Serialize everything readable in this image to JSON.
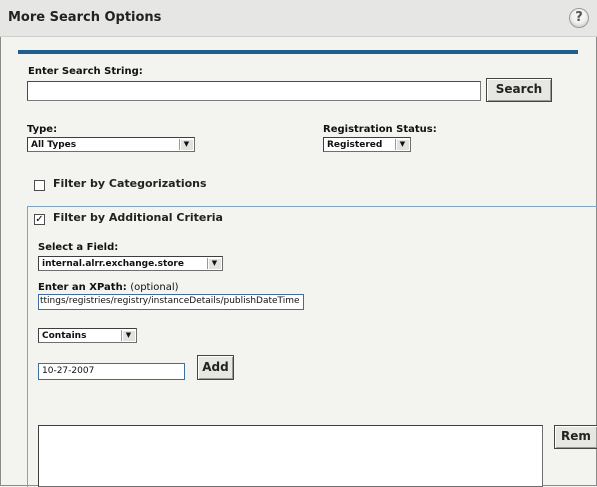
{
  "header": {
    "title": "More Search Options",
    "help_glyph": "?"
  },
  "search": {
    "label": "Enter Search String:",
    "value": "",
    "button_label": "Search"
  },
  "type_filter": {
    "label": "Type:",
    "selected": "All Types"
  },
  "registration_status": {
    "label": "Registration Status:",
    "selected": "Registered"
  },
  "categorizations": {
    "label": "Filter by Categorizations",
    "checked": false
  },
  "additional_criteria": {
    "label": "Filter by Additional Criteria",
    "checked": true,
    "check_glyph": "✓",
    "field_label": "Select a Field:",
    "field_selected": "internal.alrr.exchange.store",
    "xpath_label": "Enter an XPath:",
    "xpath_optional": "(optional)",
    "xpath_value": "ttings/registries/registry/instanceDetails/publishDateTime",
    "operator_selected": "Contains",
    "value": "10-27-2007",
    "add_label": "Add",
    "remove_label": "Rem"
  },
  "icons": {
    "dropdown": "▼"
  }
}
